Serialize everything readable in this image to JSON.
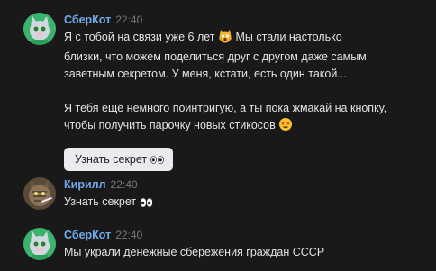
{
  "messages": [
    {
      "author": "СберКот",
      "time": "22:40",
      "paragraph1_part1": "Я с тобой на связи уже 6 лет",
      "paragraph1_part2": "Мы стали настолько",
      "paragraph1_line2": "близки, что можем поделиться друг с другом даже самым",
      "paragraph1_line3": "заветным секретом. У меня, кстати, есть один такой...",
      "paragraph2_line1": "Я тебя ещё немного поинтригую, а ты пока жмакай на кнопку,",
      "paragraph2_line2": "чтобы получить парочку новых стикосов",
      "keyboard_button_label": "Узнать секрет",
      "emoji_1": "scream-cat-emoji",
      "emoji_2": "star-struck-emoji"
    },
    {
      "author": "Кирилл",
      "time": "22:40",
      "text": "Узнать секрет",
      "emoji": "eyes-emoji"
    },
    {
      "author": "СберКот",
      "time": "22:40",
      "text": "Мы украли денежные сбережения граждан СССР"
    }
  ],
  "colors": {
    "background": "#19191a",
    "author_name": "#71aaeb",
    "timestamp": "#76787a",
    "message_text": "#e1e3e6",
    "button_bg": "#e9ebee"
  }
}
